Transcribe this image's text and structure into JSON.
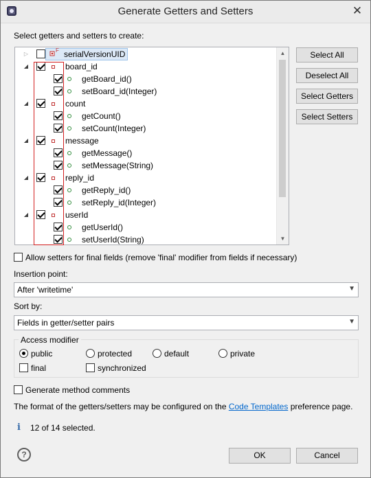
{
  "window": {
    "title": "Generate Getters and Setters",
    "close_glyph": "✕"
  },
  "tree_heading": "Select getters and setters to create:",
  "tree": {
    "top_item": {
      "label": "serialVersionUID",
      "checked": false,
      "expanded": false,
      "icon": "static-final-field-icon",
      "badge": "F"
    },
    "fields": [
      {
        "label": "board_id",
        "checked": true,
        "getter": "getBoard_id()",
        "setter": "setBoard_id(Integer)"
      },
      {
        "label": "count",
        "checked": true,
        "getter": "getCount()",
        "setter": "setCount(Integer)"
      },
      {
        "label": "message",
        "checked": true,
        "getter": "getMessage()",
        "setter": "setMessage(String)"
      },
      {
        "label": "reply_id",
        "checked": true,
        "getter": "getReply_id()",
        "setter": "setReply_id(Integer)"
      },
      {
        "label": "userId",
        "checked": true,
        "getter": "getUserId()",
        "setter": "setUserId(String)"
      }
    ]
  },
  "side_buttons": {
    "select_all": "Select All",
    "deselect_all": "Deselect All",
    "select_getters": "Select Getters",
    "select_setters": "Select Setters"
  },
  "allow_final_setters": {
    "label": "Allow setters for final fields (remove 'final' modifier from fields if necessary)",
    "checked": false
  },
  "insertion_point": {
    "label": "Insertion point:",
    "value": "After 'writetime'"
  },
  "sort_by": {
    "label": "Sort by:",
    "value": "Fields in getter/setter pairs"
  },
  "access_modifier": {
    "label": "Access modifier",
    "options": {
      "public": "public",
      "protected": "protected",
      "default": "default",
      "private": "private"
    },
    "selected": "public",
    "final_label": "final",
    "synchronized_label": "synchronized"
  },
  "generate_comments": {
    "label": "Generate method comments",
    "checked": false
  },
  "footer_text": {
    "before": "The format of the getters/setters may be configured on the",
    "link": "Code Templates",
    "after": "preference page."
  },
  "status": {
    "text": "12 of 14 selected.",
    "icon": "info-icon"
  },
  "buttons": {
    "ok": "OK",
    "cancel": "Cancel"
  },
  "colors": {
    "highlight_frame": "#d21c1c",
    "link": "#0066cc",
    "method_icon": "#2e8b3a",
    "field_icon": "#c03030"
  }
}
